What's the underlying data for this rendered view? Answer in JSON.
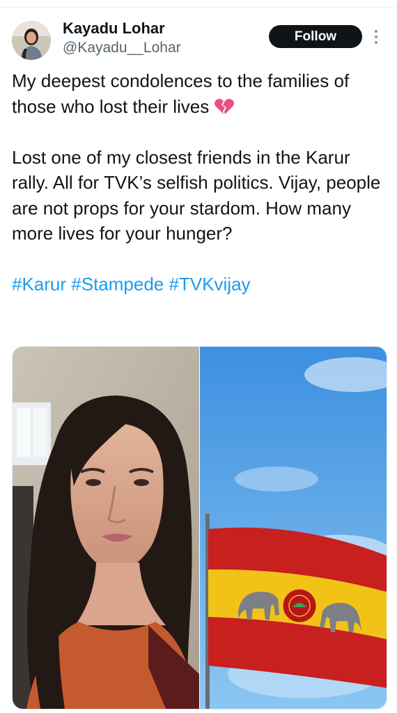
{
  "user": {
    "name": "Kayadu Lohar",
    "handle": "@Kayadu__Lohar",
    "follow_label": "Follow"
  },
  "tweet": {
    "paragraph1": "My deepest condolences to the families of those who lost their lives",
    "emoji": "broken-heart-icon",
    "paragraph2": "Lost one of my closest friends in the Karur rally. All for TVK’s selfish politics. Vijay, people are not props for your stardom. How many more lives for your hunger?",
    "hashtags": [
      "#Karur",
      "#Stampede",
      "#TVKvijay"
    ]
  },
  "media": {
    "left_image": "woman-portrait-photo",
    "right_image": "tvk-flag-photo"
  },
  "colors": {
    "link": "#1d9bf0",
    "follow_bg": "#0f1419",
    "flag_red": "#c81f1f",
    "flag_yellow": "#f2c316",
    "sky": "#5aa8e8"
  }
}
